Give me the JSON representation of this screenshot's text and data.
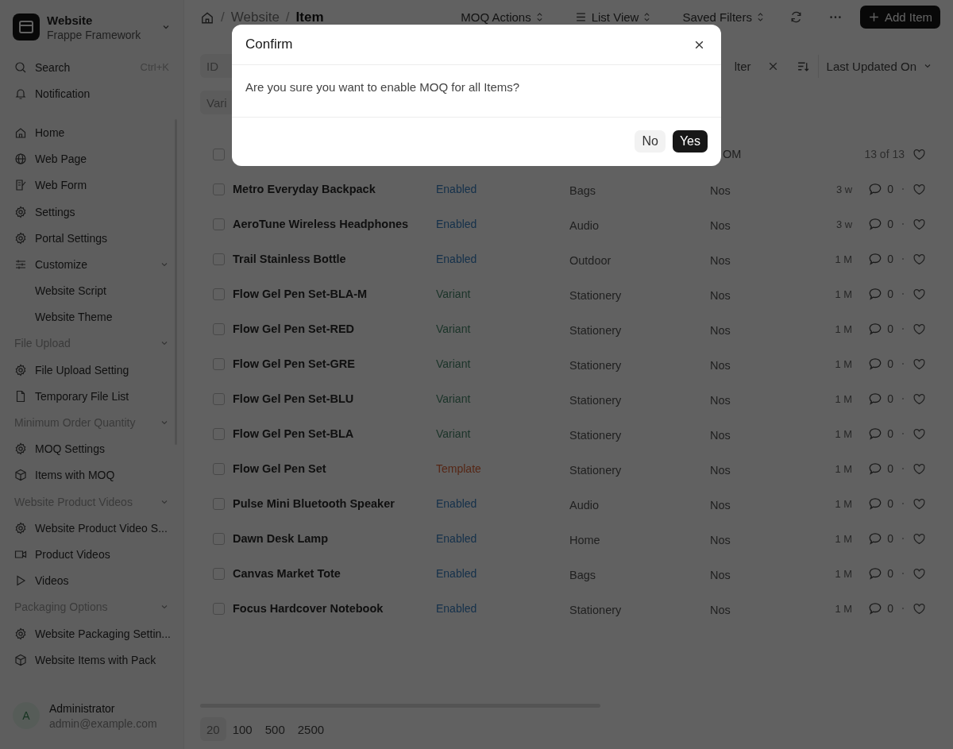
{
  "app": {
    "title": "Website",
    "subtitle": "Frappe Framework"
  },
  "sidebar": {
    "search": {
      "label": "Search",
      "shortcut": "Ctrl+K"
    },
    "notification": "Notification",
    "items": [
      {
        "label": "Home"
      },
      {
        "label": "Web Page"
      },
      {
        "label": "Web Form"
      },
      {
        "label": "Settings"
      },
      {
        "label": "Portal Settings"
      },
      {
        "label": "Customize",
        "expanded": true,
        "children": [
          {
            "label": "Website Script"
          },
          {
            "label": "Website Theme"
          }
        ]
      }
    ],
    "sections": [
      {
        "title": "File Upload",
        "expanded": true,
        "children": [
          {
            "label": "File Upload Setting"
          },
          {
            "label": "Temporary File List"
          }
        ]
      },
      {
        "title": "Minimum Order Quantity",
        "expanded": true,
        "children": [
          {
            "label": "MOQ Settings"
          },
          {
            "label": "Items with MOQ"
          }
        ]
      },
      {
        "title": "Website Product Videos",
        "expanded": true,
        "children": [
          {
            "label": "Website Product Video S..."
          },
          {
            "label": "Product Videos"
          },
          {
            "label": "Videos"
          }
        ]
      },
      {
        "title": "Packaging Options",
        "expanded": true,
        "children": [
          {
            "label": "Website Packaging Settin..."
          },
          {
            "label": "Website Items with Pack"
          }
        ]
      }
    ],
    "user": {
      "initial": "A",
      "name": "Administrator",
      "email": "admin@example.com"
    }
  },
  "breadcrumb": [
    {
      "separator": "/",
      "label": "Website"
    },
    {
      "separator": "/",
      "label": "Item"
    }
  ],
  "toolbar": {
    "buttons": [
      "MOQ Actions",
      "List View",
      "Saved Filters"
    ],
    "primary": "Add Item"
  },
  "filters": {
    "id_placeholder": "ID",
    "variant_placeholder": "Vari",
    "filter_label": "lter",
    "sort": "Last Updated On"
  },
  "table": {
    "header": {
      "uom": "OM",
      "count": "13 of 13",
      "checked": false
    },
    "rows": [
      {
        "name": "Metro Everyday Backpack",
        "status": "Enabled",
        "kind": "enabled",
        "group": "Bags",
        "uom": "Nos",
        "modified": "3 w",
        "comments": "0",
        "checked": false
      },
      {
        "name": "AeroTune Wireless Headphones",
        "status": "Enabled",
        "kind": "enabled",
        "group": "Audio",
        "uom": "Nos",
        "modified": "3 w",
        "comments": "0",
        "checked": false
      },
      {
        "name": "Trail Stainless Bottle",
        "status": "Enabled",
        "kind": "enabled",
        "group": "Outdoor",
        "uom": "Nos",
        "modified": "1 M",
        "comments": "0",
        "checked": false
      },
      {
        "name": "Flow Gel Pen Set-BLA-M",
        "status": "Variant",
        "kind": "variant",
        "group": "Stationery",
        "uom": "Nos",
        "modified": "1 M",
        "comments": "0",
        "checked": false
      },
      {
        "name": "Flow Gel Pen Set-RED",
        "status": "Variant",
        "kind": "variant",
        "group": "Stationery",
        "uom": "Nos",
        "modified": "1 M",
        "comments": "0",
        "checked": false
      },
      {
        "name": "Flow Gel Pen Set-GRE",
        "status": "Variant",
        "kind": "variant",
        "group": "Stationery",
        "uom": "Nos",
        "modified": "1 M",
        "comments": "0",
        "checked": false
      },
      {
        "name": "Flow Gel Pen Set-BLU",
        "status": "Variant",
        "kind": "variant",
        "group": "Stationery",
        "uom": "Nos",
        "modified": "1 M",
        "comments": "0",
        "checked": false
      },
      {
        "name": "Flow Gel Pen Set-BLA",
        "status": "Variant",
        "kind": "variant",
        "group": "Stationery",
        "uom": "Nos",
        "modified": "1 M",
        "comments": "0",
        "checked": false
      },
      {
        "name": "Flow Gel Pen Set",
        "status": "Template",
        "kind": "template",
        "group": "Stationery",
        "uom": "Nos",
        "modified": "1 M",
        "comments": "0",
        "checked": false
      },
      {
        "name": "Pulse Mini Bluetooth Speaker",
        "status": "Enabled",
        "kind": "enabled",
        "group": "Audio",
        "uom": "Nos",
        "modified": "1 M",
        "comments": "0",
        "checked": false
      },
      {
        "name": "Dawn Desk Lamp",
        "status": "Enabled",
        "kind": "enabled",
        "group": "Home",
        "uom": "Nos",
        "modified": "1 M",
        "comments": "0",
        "checked": false
      },
      {
        "name": "Canvas Market Tote",
        "status": "Enabled",
        "kind": "enabled",
        "group": "Bags",
        "uom": "Nos",
        "modified": "1 M",
        "comments": "0",
        "checked": false
      },
      {
        "name": "Focus Hardcover Notebook",
        "status": "Enabled",
        "kind": "enabled",
        "group": "Stationery",
        "uom": "Nos",
        "modified": "1 M",
        "comments": "0",
        "checked": false
      }
    ]
  },
  "page_sizes": [
    {
      "label": "20",
      "selected": true
    },
    {
      "label": "100",
      "selected": false
    },
    {
      "label": "500",
      "selected": false
    },
    {
      "label": "2500",
      "selected": false
    }
  ],
  "dialog": {
    "title": "Confirm",
    "message": "Are you sure you want to enable MOQ for all Items?",
    "buttons": [
      {
        "label": "No",
        "kind": "secondary"
      },
      {
        "label": "Yes",
        "kind": "primary"
      }
    ]
  }
}
